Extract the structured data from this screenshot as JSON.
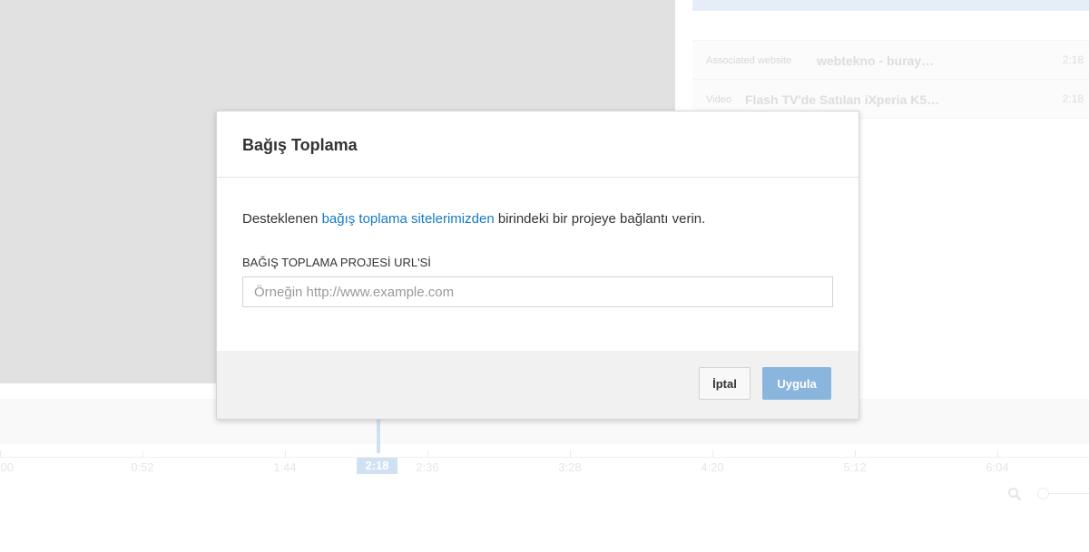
{
  "background": {
    "annotations": [
      {
        "type": "Associated website",
        "title": "webtekno - buray…",
        "time": "2:18"
      },
      {
        "type": "Video",
        "title": "Flash TV'de Satılan iXperia K5…",
        "time": "2:18"
      }
    ],
    "timeline": {
      "ticks": [
        ":00",
        "0:52",
        "1:44",
        "2:36",
        "3:28",
        "4:20",
        "5:12",
        "6:04"
      ],
      "current_time": "2:18"
    },
    "zoom_icon": "search-icon"
  },
  "dialog": {
    "title": "Bağış Toplama",
    "description_before": "Desteklenen ",
    "description_link": "bağış toplama sitelerimizden",
    "description_after": " birindeki bir projeye bağlantı verin.",
    "field_label": "BAĞIŞ TOPLAMA PROJESİ URL'Sİ",
    "url_placeholder": "Örneğin http://www.example.com",
    "url_value": "",
    "cancel_label": "İptal",
    "apply_label": "Uygula"
  },
  "colors": {
    "link": "#167ac6",
    "apply_button": "#8ab6dd",
    "playhead": "#a9c9ea"
  }
}
